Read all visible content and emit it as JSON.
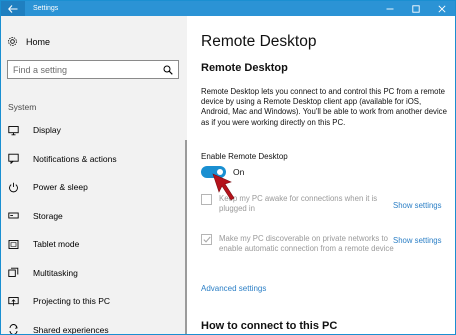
{
  "window": {
    "title": "Settings",
    "back_icon": "back-arrow-icon",
    "controls": [
      "minimize-icon",
      "maximize-icon",
      "close-icon"
    ],
    "accent": "#2b93d5"
  },
  "nav": {
    "home_label": "Home",
    "search_placeholder": "Find a setting",
    "section_label": "System",
    "items": [
      {
        "label": "Display",
        "icon": "display-icon"
      },
      {
        "label": "Notifications & actions",
        "icon": "notifications-icon"
      },
      {
        "label": "Power & sleep",
        "icon": "power-icon"
      },
      {
        "label": "Storage",
        "icon": "storage-icon"
      },
      {
        "label": "Tablet mode",
        "icon": "tablet-icon"
      },
      {
        "label": "Multitasking",
        "icon": "multitasking-icon"
      },
      {
        "label": "Projecting to this PC",
        "icon": "projecting-icon"
      },
      {
        "label": "Shared experiences",
        "icon": "shared-experiences-icon"
      }
    ]
  },
  "main": {
    "page_title": "Remote Desktop",
    "section_title": "Remote Desktop",
    "description": "Remote Desktop lets you connect to and control this PC from a remote device by using a Remote Desktop client app (available for iOS, Android, Mac and Windows). You'll be able to work from another device as if you were working directly on this PC.",
    "toggle_label": "Enable Remote Desktop",
    "toggle_state": "On",
    "toggle_on": true,
    "option1": {
      "text": "Keep my PC awake for connections when it is plugged in",
      "checked": false,
      "link": "Show settings"
    },
    "option2": {
      "text": "Make my PC discoverable on private networks to enable automatic connection from a remote device",
      "checked": true,
      "link": "Show settings"
    },
    "advanced_link": "Advanced settings",
    "how_title": "How to connect to this PC"
  }
}
